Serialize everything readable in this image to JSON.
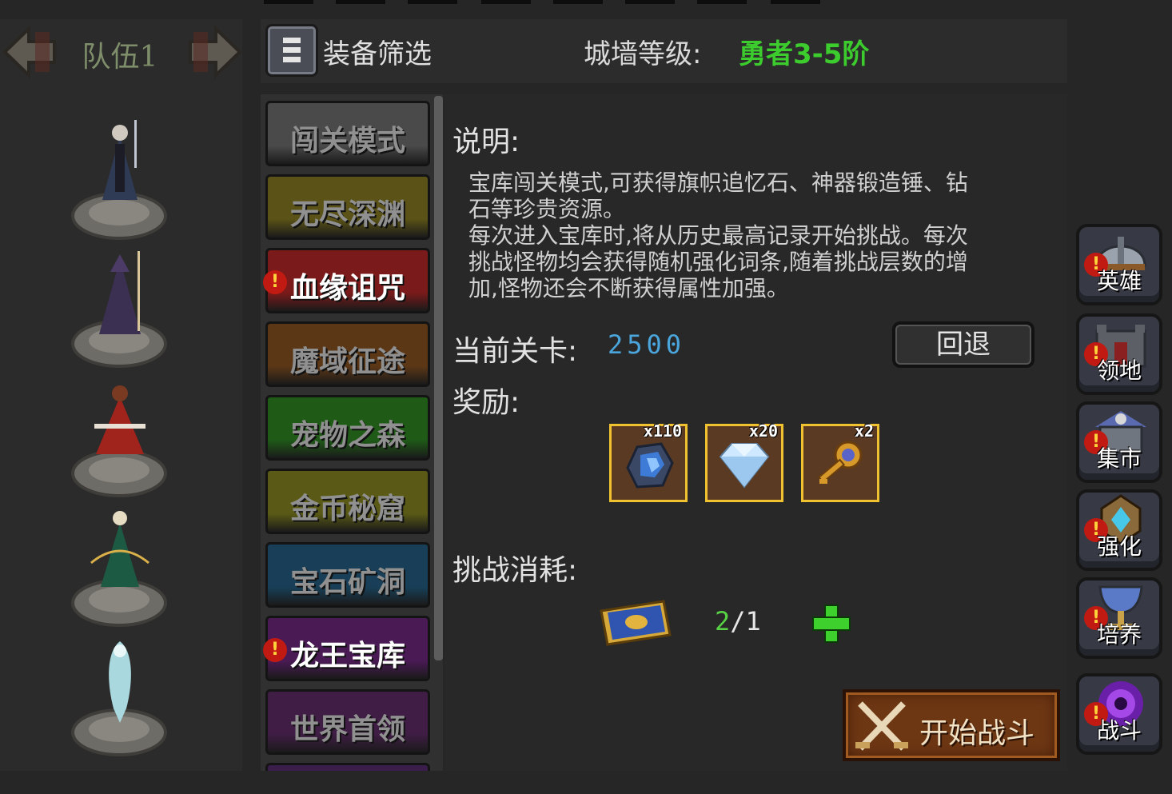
{
  "team": {
    "name": "队伍1"
  },
  "filter": {
    "label": "装备筛选"
  },
  "wall": {
    "label": "城墙等级:",
    "value": "勇者3-5阶"
  },
  "modes": [
    {
      "label": "闯关模式",
      "color": "#4a4a4a",
      "active": false,
      "alert": false
    },
    {
      "label": "无尽深渊",
      "color": "#5a5216",
      "active": false,
      "alert": false
    },
    {
      "label": "血缘诅咒",
      "color": "#7a1a1a",
      "active": true,
      "alert": true
    },
    {
      "label": "魔域征途",
      "color": "#5b3716",
      "active": false,
      "alert": false
    },
    {
      "label": "宠物之森",
      "color": "#1f5a17",
      "active": false,
      "alert": false
    },
    {
      "label": "金币秘窟",
      "color": "#5a5a16",
      "active": false,
      "alert": false
    },
    {
      "label": "宝石矿洞",
      "color": "#183f57",
      "active": false,
      "alert": false
    },
    {
      "label": "龙王宝库",
      "color": "#4a1a55",
      "active": true,
      "alert": true
    },
    {
      "label": "世界首领",
      "color": "#3f1d44",
      "active": false,
      "alert": false
    }
  ],
  "details": {
    "desc_heading": "说明:",
    "desc_line1": "宝库闯关模式,可获得旗帜追忆石、神器锻造锤、钻",
    "desc_line2": "石等珍贵资源。",
    "desc_line3": "每次进入宝库时,将从历史最高记录开始挑战。每次",
    "desc_line4": "挑战怪物均会获得随机强化词条,随着挑战层数的增",
    "desc_line5": "加,怪物还会不断获得属性加强。",
    "stage_label": "当前关卡:",
    "stage_value": "2500",
    "back_label": "回退",
    "reward_label": "奖励:",
    "rewards": [
      {
        "count": "x110",
        "icon": "blue-ore-icon"
      },
      {
        "count": "x20",
        "icon": "diamond-icon"
      },
      {
        "count": "x2",
        "icon": "golden-key-icon"
      }
    ],
    "cost_label": "挑战消耗:",
    "cost_have": "2",
    "cost_sep": "/",
    "cost_need": "1",
    "start_label": "开始战斗"
  },
  "side_nav": [
    {
      "label": "英雄",
      "icon": "helmet-icon"
    },
    {
      "label": "领地",
      "icon": "castle-icon"
    },
    {
      "label": "集市",
      "icon": "shop-icon"
    },
    {
      "label": "强化",
      "icon": "gem-emblem-icon"
    },
    {
      "label": "培养",
      "icon": "chalice-icon"
    },
    {
      "label": "战斗",
      "icon": "portal-icon"
    }
  ],
  "colors": {
    "accent_green": "#3dcc2e",
    "stage_blue": "#4aa6dd",
    "reward_border": "#f0c230",
    "alert_red": "#c01a12"
  }
}
